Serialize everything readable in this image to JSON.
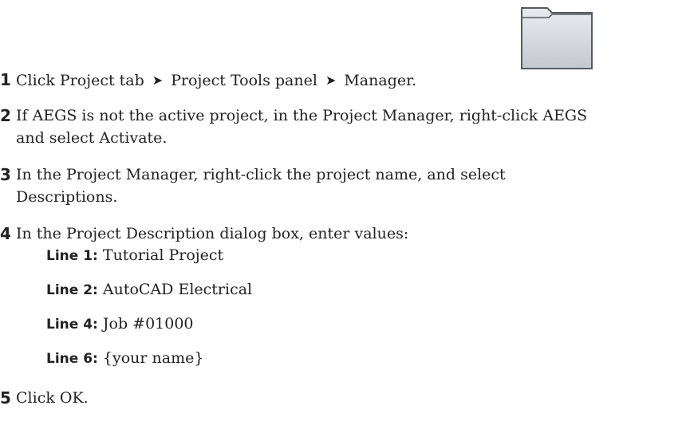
{
  "steps": [
    {
      "number": "1",
      "parts": {
        "a": "Click Project tab",
        "b": "Project Tools panel",
        "c": "Manager."
      },
      "arrow": "➤"
    },
    {
      "number": "2",
      "line1": "If AEGS is not the active project, in the Project Manager, right-click AEGS",
      "line2": "and select Activate."
    },
    {
      "number": "3",
      "line1": "In the Project Manager, right-click the project name, and select",
      "line2": "Descriptions."
    },
    {
      "number": "4",
      "line1": "In the Project Description dialog box, enter values:",
      "values": [
        {
          "label": "Line 1:",
          "value": "Tutorial Project"
        },
        {
          "label": "Line 2:",
          "value": "AutoCAD Electrical"
        },
        {
          "label": "Line 4:",
          "value": "Job #01000"
        },
        {
          "label": "Line 6:",
          "value": "{your name}"
        }
      ]
    },
    {
      "number": "5",
      "line1": "Click OK."
    }
  ],
  "icon": "project-manager-folder-icon"
}
